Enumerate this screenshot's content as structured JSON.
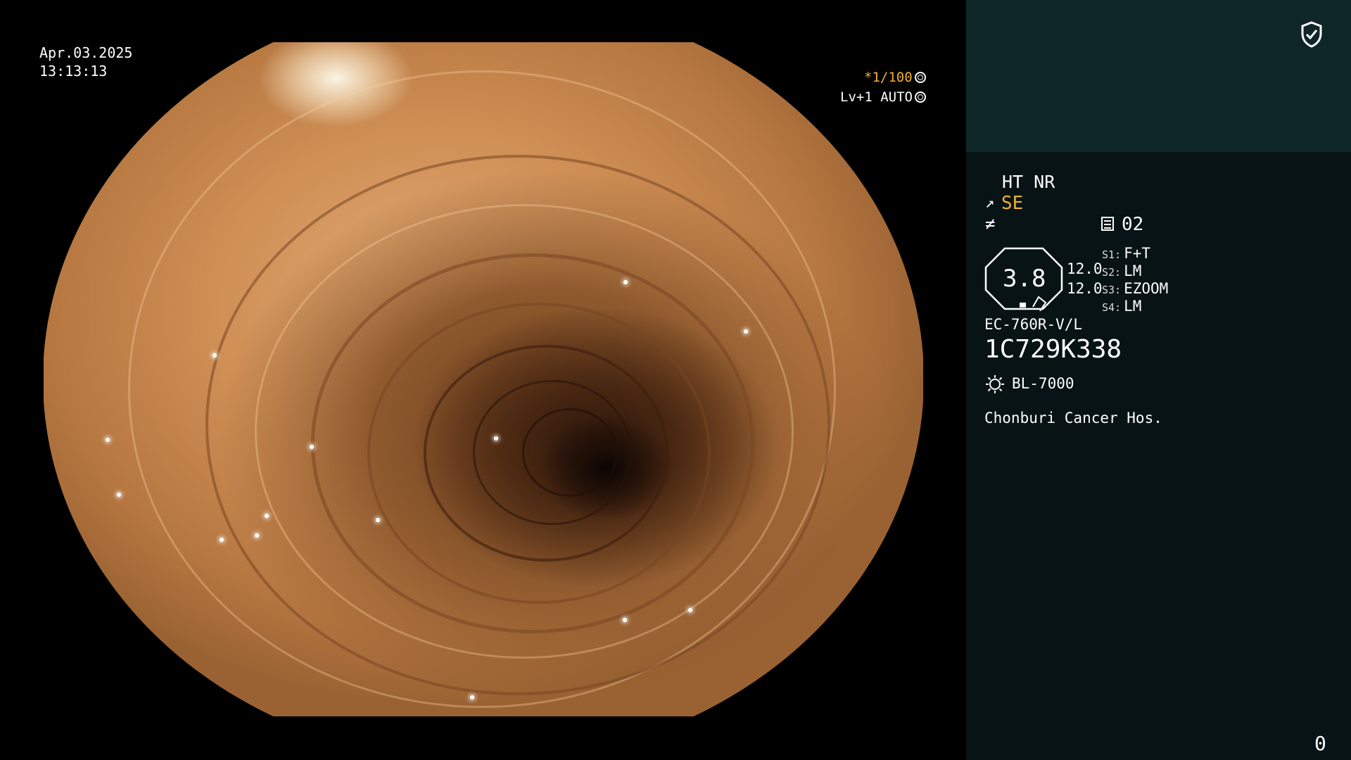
{
  "overlay": {
    "date": "Apr.03.2025",
    "time": "13:13:13",
    "shutter": "*1/100",
    "shutter_color": "#f0b030",
    "level": "Lv+1 AUTO"
  },
  "panel": {
    "mode": "HT NR",
    "enhance": "SE",
    "enhance_color": "#f0b030",
    "memory": "02",
    "gauge": "3.8",
    "value1": "12.0",
    "value2": "12.0",
    "slots": [
      {
        "key": "S1:",
        "value": "F+T"
      },
      {
        "key": "S2:",
        "value": "LM"
      },
      {
        "key": "S3:",
        "value": "EZOOM"
      },
      {
        "key": "S4:",
        "value": "LM"
      }
    ],
    "scope_model": "EC-760R-V/L",
    "serial": "1C729K338",
    "light_source": "BL-7000",
    "hospital": "Chonburi Cancer Hos.",
    "counter": "0"
  },
  "icons": {
    "shield": "shield-check-icon",
    "shutter": "aperture-icon",
    "level": "iris-icon",
    "enhance": "structure-enhance-icon",
    "filter": "filter-icon",
    "memory": "memory-icon",
    "light": "light-source-icon"
  },
  "colors": {
    "panel_bg": "#071314",
    "panel_top_bg": "#0e2627",
    "accent": "#f0b030"
  }
}
